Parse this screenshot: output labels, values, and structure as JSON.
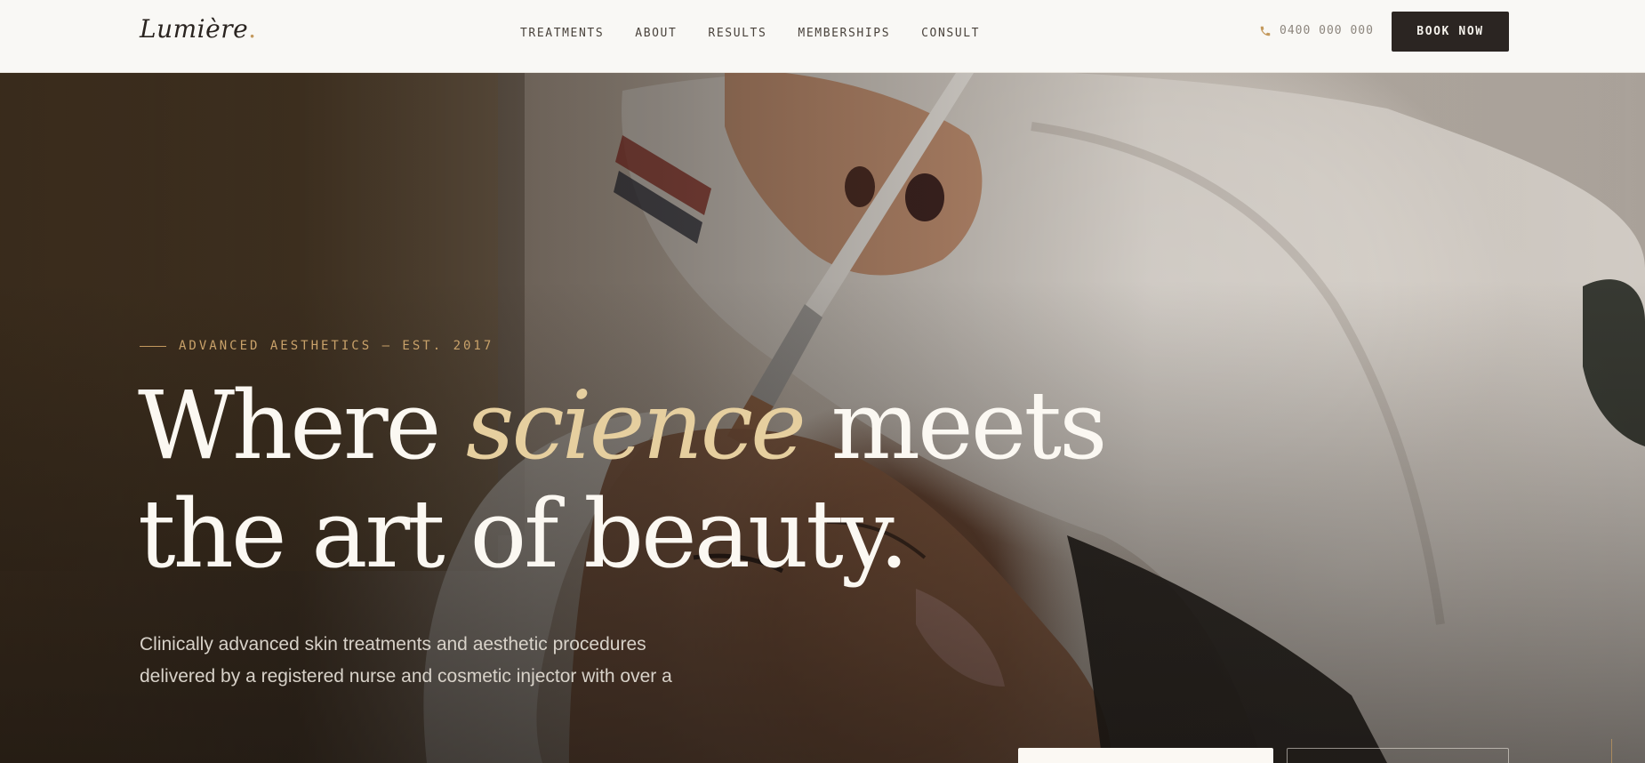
{
  "brand": {
    "name": "Lumière",
    "dot": "."
  },
  "nav": {
    "links": [
      "TREATMENTS",
      "ABOUT",
      "RESULTS",
      "MEMBERSHIPS",
      "CONSULT"
    ],
    "phone": "0400 000 000",
    "book_label": "BOOK NOW"
  },
  "hero": {
    "eyebrow": "ADVANCED AESTHETICS — EST. 2017",
    "headline": {
      "part1": "Where ",
      "accent": "science",
      "part2": " meets",
      "line2": "the art of beauty."
    },
    "description": "Clinically advanced skin treatments and aesthetic procedures delivered by a registered nurse and cosmetic injector with over a"
  },
  "icons": {
    "phone": "phone-icon"
  },
  "colors": {
    "accent_gold": "#c49a5e",
    "headline_accent": "#e6cf9f",
    "dark": "#2b2522",
    "nav_bg": "#f9f8f5"
  }
}
